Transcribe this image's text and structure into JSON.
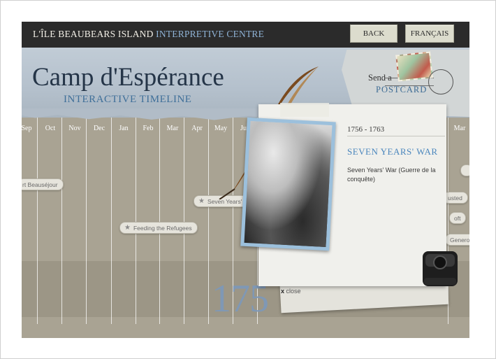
{
  "header": {
    "brand_part1": "L'ÎLE BEAUBEARS ISLAND",
    "brand_part2": "INTERPRETIVE CENTRE",
    "back_label": "BACK",
    "language_label": "FRANÇAIS"
  },
  "banner": {
    "title": "Camp d'Espérance",
    "subtitle": "INTERACTIVE TIMELINE"
  },
  "postcard": {
    "send_label": "Send a",
    "postcard_label": "POSTCARD"
  },
  "timeline": {
    "months": [
      "Sep",
      "Oct",
      "Nov",
      "Dec",
      "Jan",
      "Feb",
      "Mar",
      "Apr",
      "May",
      "Jun",
      "Mar"
    ],
    "events": [
      "rt Beauséjour",
      "Seven Years' W",
      "Feeding the Refugees",
      "usted",
      "oft",
      "Generou"
    ],
    "year": "175"
  },
  "card": {
    "dates": "1756 - 1763",
    "title": "SEVEN YEARS' WAR",
    "description": "Seven Years' War (Guerre de la conquête)",
    "close_label": "close",
    "close_symbol": "x"
  },
  "slider": {
    "handle_symbol": "◂▸"
  },
  "colors": {
    "accent_blue": "#4a86bd",
    "topbar": "#2b2b2b",
    "handle": "#5387c7"
  }
}
